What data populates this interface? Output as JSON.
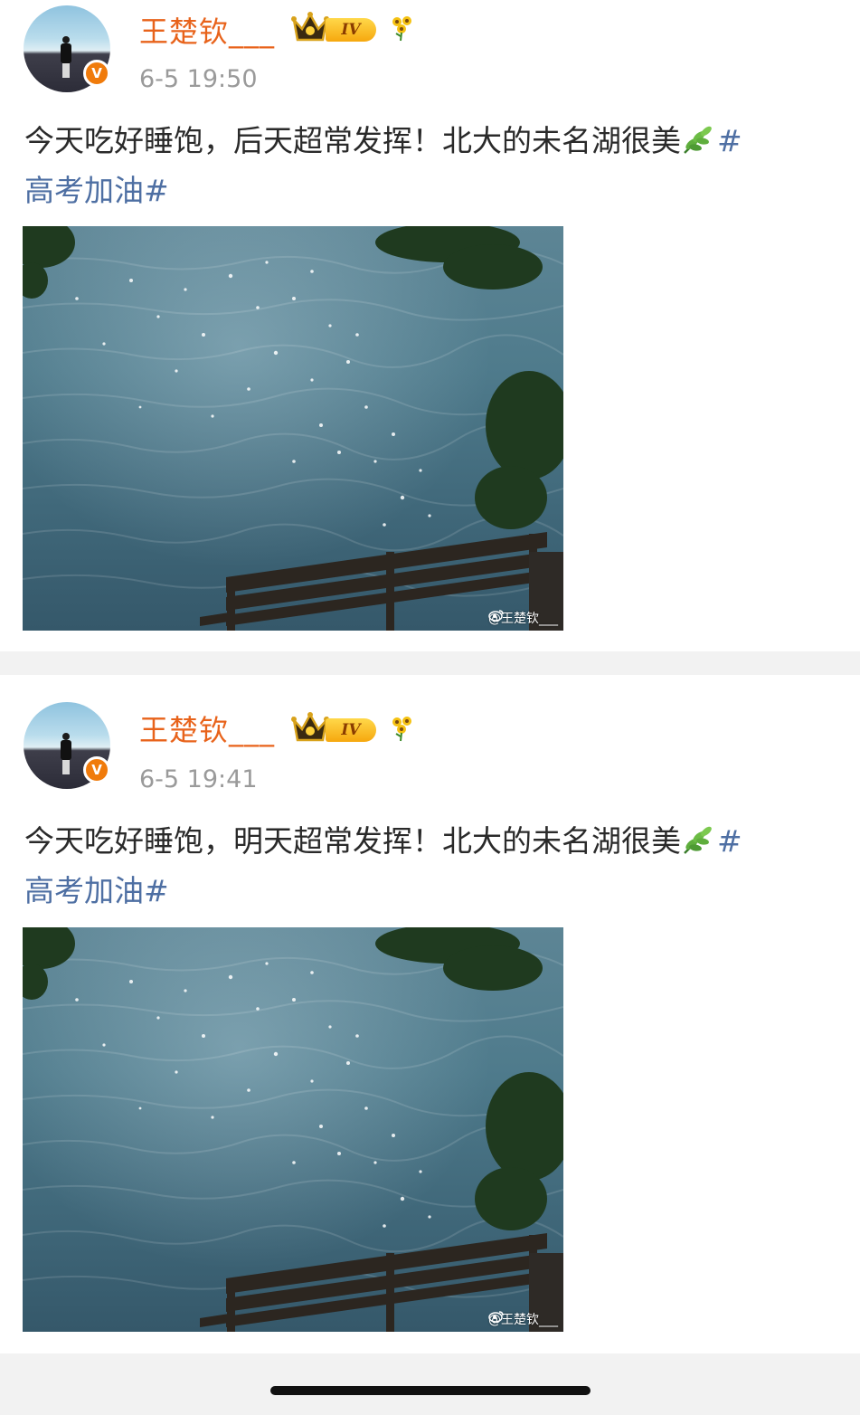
{
  "posts": [
    {
      "username": "王楚钦___",
      "level": "IV",
      "verified_mark": "V",
      "time": "6-5 19:50",
      "text": "今天吃好睡饱，后天超常发挥！北大的未名湖很美",
      "hashtag_start": "#",
      "hashtag_rest": "高考加油#",
      "watermark": "@王楚钦___"
    },
    {
      "username": "王楚钦___",
      "level": "IV",
      "verified_mark": "V",
      "time": "6-5 19:41",
      "text": "今天吃好睡饱，明天超常发挥！北大的未名湖很美",
      "hashtag_start": "#",
      "hashtag_rest": "高考加油#",
      "watermark": "@王楚钦___"
    }
  ],
  "icons": [
    "avatar",
    "verified-badge",
    "crown-icon",
    "level-badge",
    "sunflower-icon",
    "leaf-emoji-icon",
    "weibo-logo-icon"
  ],
  "colors": {
    "username": "#e8631b",
    "hashtag": "#4e6fa3",
    "timestamp": "#9a9a9a",
    "body_text": "#2a2a2a",
    "separator": "#f2f2f2"
  }
}
